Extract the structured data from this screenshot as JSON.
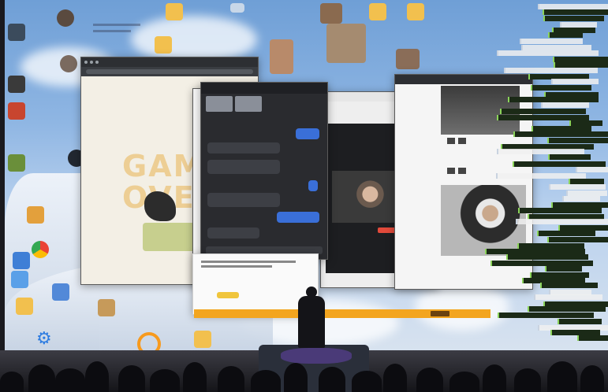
{
  "scene": {
    "description_tags": [
      "projected-desktop",
      "stage",
      "speaker",
      "audience"
    ]
  },
  "game_window": {
    "overlay_text": "GAME\nOVE"
  },
  "chat_window": {
    "messages": [
      {
        "side": "me",
        "text": ""
      },
      {
        "side": "them",
        "text": ""
      },
      {
        "side": "them",
        "text": ""
      },
      {
        "side": "me",
        "text": ""
      },
      {
        "side": "them",
        "text": ""
      },
      {
        "side": "me",
        "text": ""
      },
      {
        "side": "them",
        "text": ""
      }
    ]
  },
  "colors": {
    "wall_top": "#6f9fd6",
    "banner": "#f3a51f",
    "chat_me": "#3a6fd8",
    "tag_green": "#8bd35a",
    "tag_dark": "#1b2a17"
  },
  "tags": {
    "count": 58
  }
}
